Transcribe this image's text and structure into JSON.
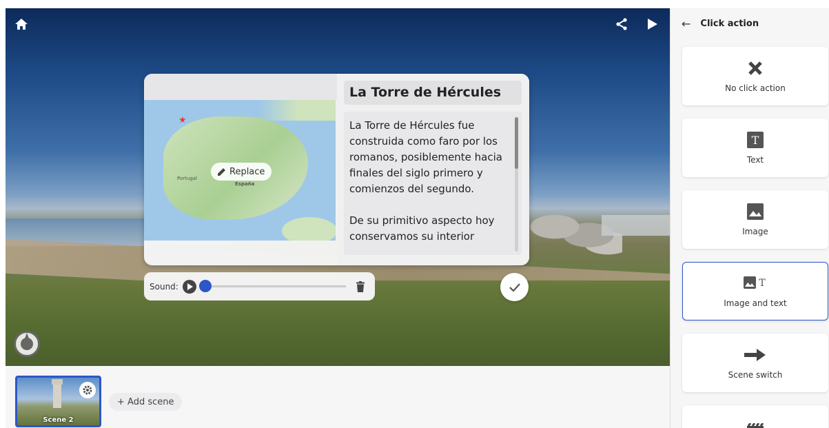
{
  "viewer": {
    "top_icons": [
      "home-icon",
      "share-icon",
      "play-icon"
    ],
    "compass_icon": "compass-icon"
  },
  "hotspot": {
    "title": "La Torre de Hércules",
    "description": "La Torre de Hércules fue construida como faro por los romanos, posiblemente hacia finales del siglo primero y comienzos del segundo.\n\nDe su primitivo aspecto hoy conservamos su interior",
    "replace_label": "Replace",
    "map_label_country": "España",
    "map_label_portugal": "Portugal",
    "sound_label": "Sound:"
  },
  "scenes": {
    "items": [
      {
        "name": "Scene 2"
      }
    ],
    "add_label": "+ Add scene"
  },
  "panel": {
    "title": "Click action",
    "options": [
      {
        "label": "No click action",
        "icon": "x-icon"
      },
      {
        "label": "Text",
        "icon": "text-icon"
      },
      {
        "label": "Image",
        "icon": "image-icon"
      },
      {
        "label": "Image and text",
        "icon": "image-text-icon",
        "selected": true
      },
      {
        "label": "Scene switch",
        "icon": "arrow-right-icon"
      }
    ]
  },
  "colors": {
    "accent": "#2d56c7"
  }
}
